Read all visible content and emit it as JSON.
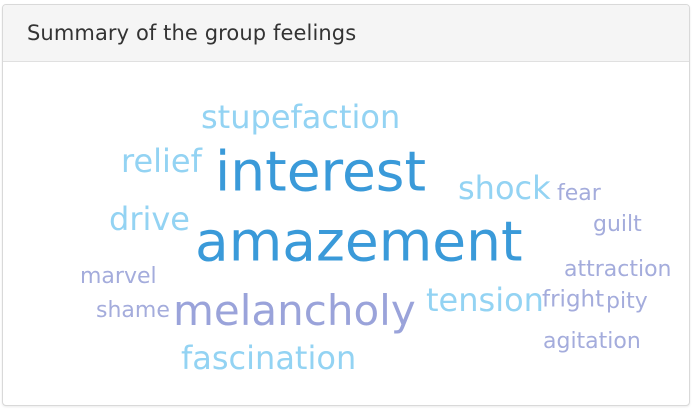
{
  "card": {
    "title": "Summary of the group feelings"
  },
  "colors": {
    "dark_blue": "#3a9ad9",
    "light_blue": "#93d3f3",
    "lavender": "#a4acdc",
    "melancholy": "#9aa3da"
  },
  "words": [
    {
      "id": "stupefaction",
      "text": "stupefaction",
      "color": "light_blue",
      "weight": 4
    },
    {
      "id": "relief",
      "text": "relief",
      "color": "light_blue",
      "weight": 4
    },
    {
      "id": "interest",
      "text": "interest",
      "color": "dark_blue",
      "weight": 7
    },
    {
      "id": "shock",
      "text": "shock",
      "color": "light_blue",
      "weight": 4
    },
    {
      "id": "fear",
      "text": "fear",
      "color": "lavender",
      "weight": 2
    },
    {
      "id": "drive",
      "text": "drive",
      "color": "light_blue",
      "weight": 4
    },
    {
      "id": "guilt",
      "text": "guilt",
      "color": "lavender",
      "weight": 2
    },
    {
      "id": "amazement",
      "text": "amazement",
      "color": "dark_blue",
      "weight": 7
    },
    {
      "id": "attraction",
      "text": "attraction",
      "color": "lavender",
      "weight": 2
    },
    {
      "id": "marvel",
      "text": "marvel",
      "color": "lavender",
      "weight": 2
    },
    {
      "id": "tension",
      "text": "tension",
      "color": "light_blue",
      "weight": 4
    },
    {
      "id": "fright",
      "text": "fright",
      "color": "lavender",
      "weight": 2
    },
    {
      "id": "pity",
      "text": "pity",
      "color": "lavender",
      "weight": 2
    },
    {
      "id": "shame",
      "text": "shame",
      "color": "lavender",
      "weight": 2
    },
    {
      "id": "melancholy",
      "text": "melancholy",
      "color": "melancholy",
      "weight": 5
    },
    {
      "id": "agitation",
      "text": "agitation",
      "color": "lavender",
      "weight": 2
    },
    {
      "id": "fascination",
      "text": "fascination",
      "color": "light_blue",
      "weight": 4
    }
  ]
}
